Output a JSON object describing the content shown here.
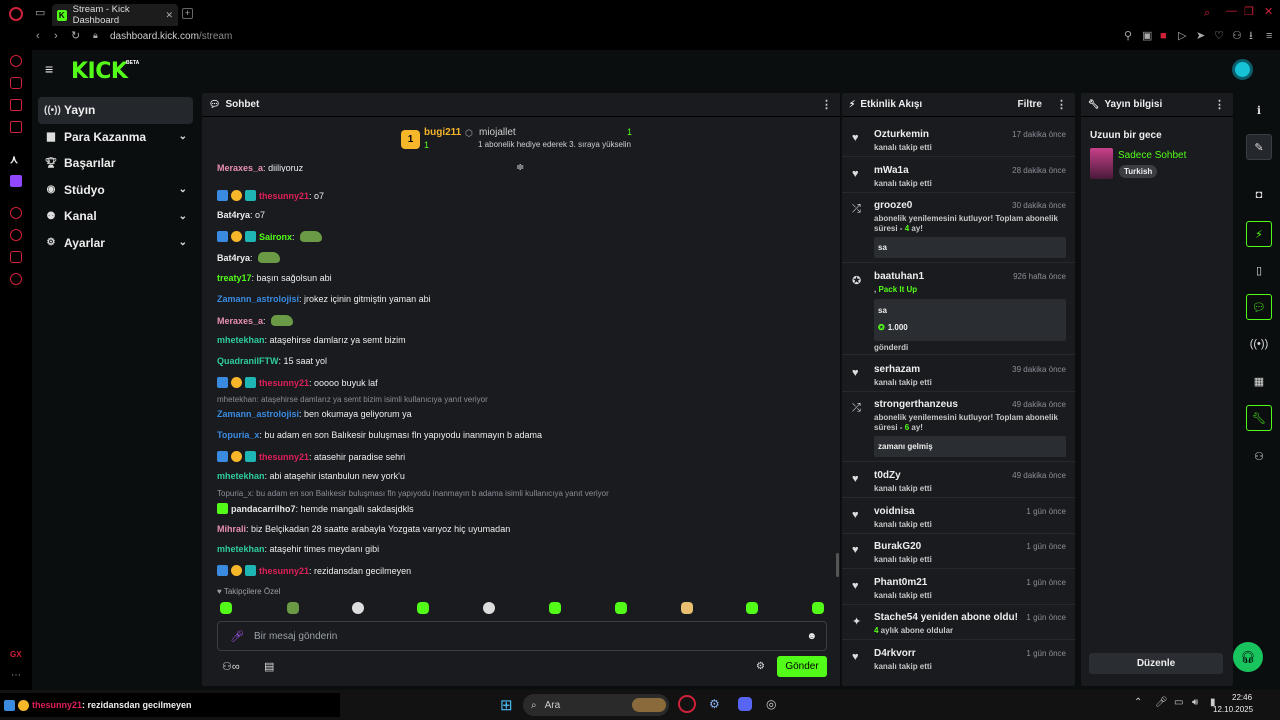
{
  "browser": {
    "tab_title": "Stream - Kick Dashboard",
    "url_domain": "dashboard.kick.com",
    "url_path": "/stream"
  },
  "app": {
    "logo": "KICK",
    "beta": "BETA"
  },
  "nav": [
    {
      "label": "Yayın",
      "icon": "broadcast-icon",
      "active": true
    },
    {
      "label": "Para Kazanma",
      "icon": "money-icon"
    },
    {
      "label": "Başarılar",
      "icon": "trophy-icon"
    },
    {
      "label": "Stüdyo",
      "icon": "studio-icon"
    },
    {
      "label": "Kanal",
      "icon": "channel-icon"
    },
    {
      "label": "Ayarlar",
      "icon": "settings-icon"
    }
  ],
  "chat": {
    "title": "Sohbet",
    "pinned": {
      "rank": "1",
      "user": "bugi211",
      "user_count": "1",
      "gifter": "miojallet",
      "gifter_count": "1",
      "note": "1 abonelik hediye ederek 3. sıraya yükselin"
    },
    "messages": [
      {
        "user": "Meraxes_a",
        "text": "diiliyoruz",
        "color": "#e88fb0"
      },
      {
        "user": "thesunny21",
        "text": "o7",
        "color": "#e01f5a",
        "badges": true
      },
      {
        "user": "Bat4rya",
        "text": "o7",
        "color": "#eeeeee"
      },
      {
        "user": "Saironx",
        "text": "",
        "color": "#53fc18",
        "badges": true,
        "emote": true
      },
      {
        "user": "Bat4rya",
        "text": "",
        "color": "#eeeeee",
        "emote": true
      },
      {
        "user": "treaty17",
        "text": "başın sağolsun abi",
        "color": "#53fc18"
      },
      {
        "user": "Zamann_astrolojisi",
        "text": "jrokez içinin gitmiştin yaman abi",
        "color": "#3a8be0"
      },
      {
        "user": "Meraxes_a",
        "text": "",
        "color": "#e88fb0",
        "emote": true
      },
      {
        "user": "mhetekhan",
        "text": "ataşehirse damlarız ya semt bizim",
        "color": "#2ecc9f"
      },
      {
        "user": "QuadranilFTW",
        "text": "15 saat yol",
        "color": "#2ecc9f"
      },
      {
        "user": "thesunny21",
        "text": "ooooo buyuk laf",
        "color": "#e01f5a",
        "badges": true
      },
      {
        "user": "Zamann_astrolojisi",
        "text": "ben okumaya geliyorum ya",
        "color": "#3a8be0",
        "reply": "mhetekhan: ataşehirse damlarız ya semt bizim isimli kullanıcıya yanıt veriyor"
      },
      {
        "user": "Topuria_x",
        "text": "bu adam en son Balıkesir buluşması fln yapıyodu inanmayın b adama",
        "color": "#3a8be0"
      },
      {
        "user": "thesunny21",
        "text": "atasehir paradise sehri",
        "color": "#e01f5a",
        "badges": true
      },
      {
        "user": "mhetekhan",
        "text": "abi ataşehir istanbulun new york'u",
        "color": "#2ecc9f"
      },
      {
        "user": "pandacarrilho7",
        "text": "hemde mangallı sakdasjdkls",
        "color": "#e8e8e8",
        "reply": "Topuria_x: bu adam en son Balıkesir buluşması fln yapıyodu inanmayın b adama isimli kullanıcıya yanıt veriyor",
        "badge_green": true
      },
      {
        "user": "Mihrali",
        "text": "biz Belçikadan 28 saatte arabayla Yozgata varıyoz hiç uyumadan",
        "color": "#e88fb0"
      },
      {
        "user": "mhetekhan",
        "text": "ataşehir times meydanı gibi",
        "color": "#2ecc9f"
      },
      {
        "user": "thesunny21",
        "text": "rezidansdan gecilmeyen",
        "color": "#e01f5a",
        "badges": true
      }
    ],
    "followers_only": "Takipçilere Özel",
    "input_placeholder": "Bir mesaj gönderin",
    "send_label": "Gönder"
  },
  "activity": {
    "title": "Etkinlik Akışı",
    "filter": "Filtre",
    "items": [
      {
        "user": "Ozturkemin",
        "time": "17 dakika önce",
        "sub": "kanalı takip etti",
        "icon": "heart-icon"
      },
      {
        "user": "mWa1a",
        "time": "28 dakika önce",
        "sub": "kanalı takip etti",
        "icon": "heart-icon"
      },
      {
        "user": "grooze0",
        "time": "30 dakika önce",
        "sub_a": "abonelik yenilemesini kutluyor! Toplam abonelik",
        "sub_b_pre": "süresi - ",
        "sub_b_num": "4",
        "sub_b_post": " ay!",
        "box": "sa",
        "icon": "renew-icon"
      },
      {
        "user": "baatuhan1",
        "time": "926 hafta önce",
        "gift_pre": ", ",
        "gift_name": "Pack It Up",
        "box": "sa",
        "kicks": "1.000",
        "sent": "gönderdi",
        "icon": "kick-coin-icon"
      },
      {
        "user": "serhazam",
        "time": "39 dakika önce",
        "sub": "kanalı takip etti",
        "icon": "heart-icon"
      },
      {
        "user": "strongerthanzeus",
        "time": "49 dakika önce",
        "sub_a": "abonelik yenilemesini kutluyor! Toplam abonelik",
        "sub_b_pre": "süresi - ",
        "sub_b_num": "6",
        "sub_b_post": " ay!",
        "box": "zamanı gelmiş",
        "icon": "renew-icon"
      },
      {
        "user": "t0dZy",
        "time": "49 dakika önce",
        "sub": "kanalı takip etti",
        "icon": "heart-icon"
      },
      {
        "user": "voidnisa",
        "time": "1 gün önce",
        "sub": "kanalı takip etti",
        "icon": "heart-icon"
      },
      {
        "user": "BurakG20",
        "time": "1 gün önce",
        "sub": "kanalı takip etti",
        "icon": "heart-icon"
      },
      {
        "user": "Phant0m21",
        "time": "1 gün önce",
        "sub": "kanalı takip etti",
        "icon": "heart-icon"
      },
      {
        "user": "Stache54 yeniden abone oldu!",
        "time": "1 gün önce",
        "sub_num": "4",
        "sub_tail": " aylık abone oldular",
        "icon": "sparkle-icon"
      },
      {
        "user": "D4rkvorr",
        "time": "1 gün önce",
        "sub": "kanalı takip etti",
        "icon": "heart-icon"
      }
    ]
  },
  "info": {
    "title": "Yayın bilgisi",
    "stream_title": "Uzuun bir gece",
    "category": "Sadece Sohbet",
    "language": "Turkish",
    "edit": "Düzenle"
  },
  "taskbar": {
    "search": "Ara",
    "time": "22:46",
    "date": "12.10.2025",
    "notif_user": "thesunny21",
    "notif_text": ": rezidansdan gecilmeyen",
    "gx": "GX"
  },
  "colors": {
    "accent": "#53fc18",
    "bg": "#0b0e0f",
    "panel": "#191b1f",
    "opera": "#d0203a"
  }
}
